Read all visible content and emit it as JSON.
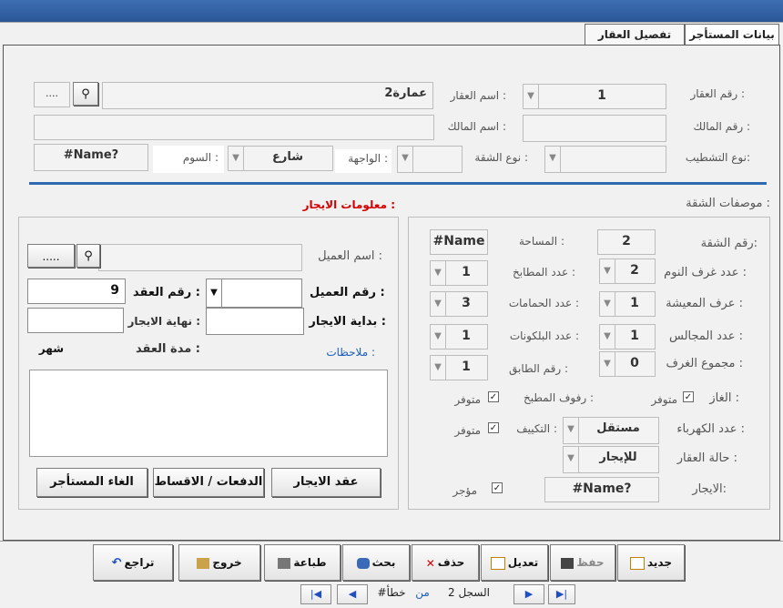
{
  "tabs": [
    "بيانات المستأجر",
    "تفصيل العقار"
  ],
  "property": {
    "number_label": "رقم العقار :",
    "number_value": "1",
    "name_label": "اسم العقار :",
    "name_value": "عمارة2",
    "owner_number_label": "رقم المالك :",
    "owner_name_label": "اسم المالك :",
    "finishing_type_label": "نوع التشطيب:",
    "apartment_type_label": "نوع الشقة :",
    "facade_label": "الواجهة :",
    "facade_value": "شارع",
    "price_label": "السوم :",
    "price_value": "#Name?",
    "browse_label": "...."
  },
  "apartment": {
    "section_title": "موصفات الشقة :",
    "number_label": "رقم الشقة:",
    "number_value": "2",
    "area_label": "المساحة :",
    "area_value": "#Name",
    "bedrooms_label": "عدد غرف النوم :",
    "bedrooms_value": "2",
    "kitchens_label": "عدد المطابخ :",
    "kitchens_value": "1",
    "living_label": "عرف المعيشة :",
    "living_value": "1",
    "bathrooms_label": "عدد الحمامات :",
    "bathrooms_value": "3",
    "majlis_label": "عدد المجالس :",
    "majlis_value": "1",
    "balconies_label": "عدد البلكونات :",
    "balconies_value": "1",
    "total_rooms_label": "مجموع الغرف :",
    "total_rooms_value": "0",
    "floor_label": "رقم الطابق :",
    "floor_value": "1",
    "gas_label": "الغاز :",
    "gas_text": "متوفر",
    "kitchen_shelves_label": "رفوف المطبخ :",
    "kitchen_shelves_text": "متوفر",
    "meters_label": "عدد الكهرباء :",
    "meters_value": "مستقل",
    "ac_label": "التكييف :",
    "ac_text": "متوفر",
    "status_label": "حالة العقار :",
    "status_value": "للإيجار",
    "rent_label": "الايجار:",
    "rent_value": "#Name?",
    "rented_text": "مؤجر"
  },
  "rental": {
    "section_title": "معلومات الايجار :",
    "customer_name_label": "اسم العميل :",
    "browse_label": ".....",
    "customer_number_label": "رقم العميل :",
    "contract_number_label": "رقم العقد :",
    "contract_number_value": "9",
    "start_label": "بداية الايجار :",
    "end_label": "نهاية الايجار :",
    "duration_label": "مدة العقد :",
    "duration_value": "شهر",
    "notes_label": "ملاحظات :",
    "btn_contract": "عقد الايجار",
    "btn_payments": "الدفعات / الاقساط",
    "btn_cancel_tenant": "الغاء المستأجر"
  },
  "toolbar": {
    "new": "جديد",
    "save": "حفظ",
    "edit": "تعديل",
    "delete": "حذف",
    "search": "بحث",
    "print": "طباعة",
    "exit": "خروج",
    "undo": "تراجع"
  },
  "record_nav": {
    "record_label": "السجل 2",
    "of_label": "من",
    "error_label": "#خطأ"
  },
  "colors": {
    "accent_rule": "#2f6bb0",
    "rental_title": "#d40000",
    "notes_label": "#1f5fb8"
  }
}
